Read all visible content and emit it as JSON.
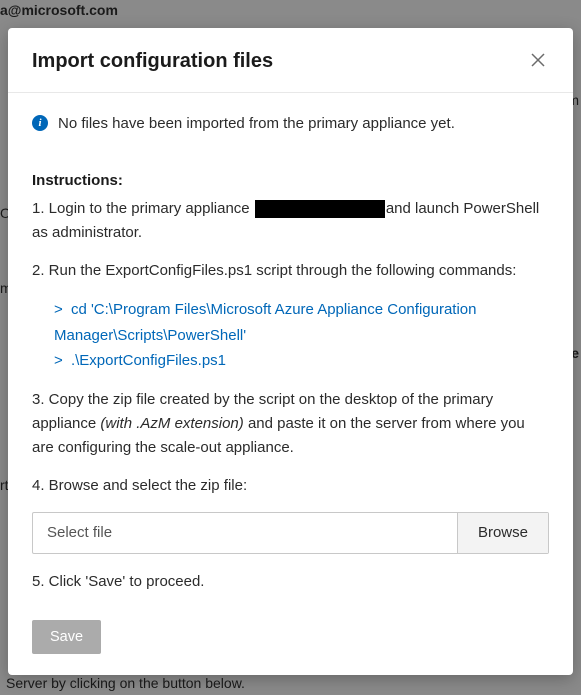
{
  "backdrop": {
    "top": "a@microsoft.com",
    "right_om": "om",
    "left_m": "m",
    "right_ne": "ne",
    "left_o": "O",
    "left_rt": "rt",
    "bottom": "Server by clicking on the button below."
  },
  "modal": {
    "title": "Import configuration files",
    "info_text": "No files have been imported from the primary appliance yet.",
    "instructions_heading": "Instructions:",
    "step1_before": "1. Login to the primary appliance ",
    "step1_after": "and launch PowerShell as administrator.",
    "step2": "2. Run the ExportConfigFiles.ps1 script through the following commands:",
    "cmd_prefix": ">",
    "cmd1": "cd 'C:\\Program Files\\Microsoft Azure Appliance Configuration Manager\\Scripts\\PowerShell'",
    "cmd2": ".\\ExportConfigFiles.ps1",
    "step3_before": "3. Copy the zip file created by the script on the desktop of the primary appliance ",
    "step3_italic": "(with .AzM extension)",
    "step3_after": " and paste it on the server from where you are configuring the scale-out appliance.",
    "step4": "4. Browse and select the zip file:",
    "file_placeholder": "Select file",
    "browse_label": "Browse",
    "step5": "5. Click 'Save' to proceed.",
    "save_label": "Save"
  }
}
